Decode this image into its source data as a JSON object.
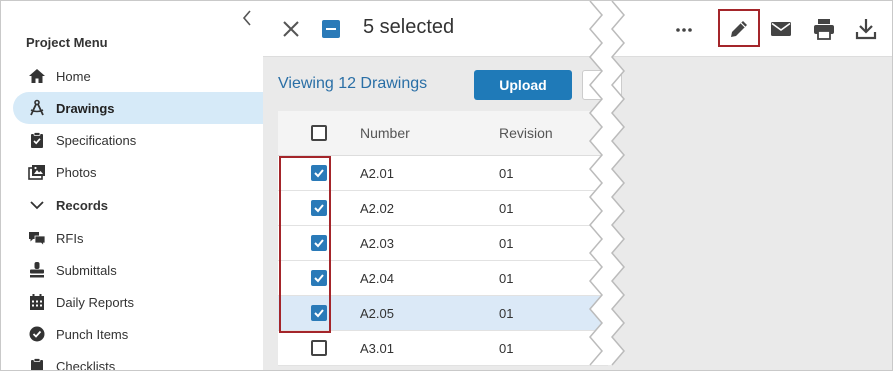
{
  "sidebar": {
    "menu_title": "Project Menu",
    "items": [
      {
        "label": "Home",
        "icon": "home-icon"
      },
      {
        "label": "Drawings",
        "icon": "drawings-icon",
        "active": true
      },
      {
        "label": "Specifications",
        "icon": "specifications-icon"
      },
      {
        "label": "Photos",
        "icon": "photos-icon"
      },
      {
        "label": "Records",
        "icon": "chevron-down-icon"
      },
      {
        "label": "RFIs",
        "icon": "rfis-icon"
      },
      {
        "label": "Submittals",
        "icon": "submittals-icon"
      },
      {
        "label": "Daily Reports",
        "icon": "calendar-icon"
      },
      {
        "label": "Punch Items",
        "icon": "check-circle-icon"
      },
      {
        "label": "Checklists",
        "icon": "clipboard-icon"
      }
    ]
  },
  "topbar": {
    "selected_text": "5 selected"
  },
  "drawings": {
    "viewing_text": "Viewing 12 Drawings",
    "upload_label": "Upload",
    "columns": [
      "Number",
      "Revision"
    ],
    "rows": [
      {
        "number": "A2.01",
        "revision": "01",
        "checked": true
      },
      {
        "number": "A2.02",
        "revision": "01",
        "checked": true
      },
      {
        "number": "A2.03",
        "revision": "01",
        "checked": true
      },
      {
        "number": "A2.04",
        "revision": "01",
        "checked": true
      },
      {
        "number": "A2.05",
        "revision": "01",
        "checked": true
      },
      {
        "number": "A3.01",
        "revision": "01",
        "checked": false
      }
    ]
  },
  "toolbar": {
    "icons": [
      "more-icon",
      "pencil-icon",
      "mail-icon",
      "print-icon",
      "download-icon"
    ]
  },
  "colors": {
    "accent": "#2a7ab8",
    "active_bg": "#d6eaf8",
    "highlight_outline": "#a4252a"
  }
}
